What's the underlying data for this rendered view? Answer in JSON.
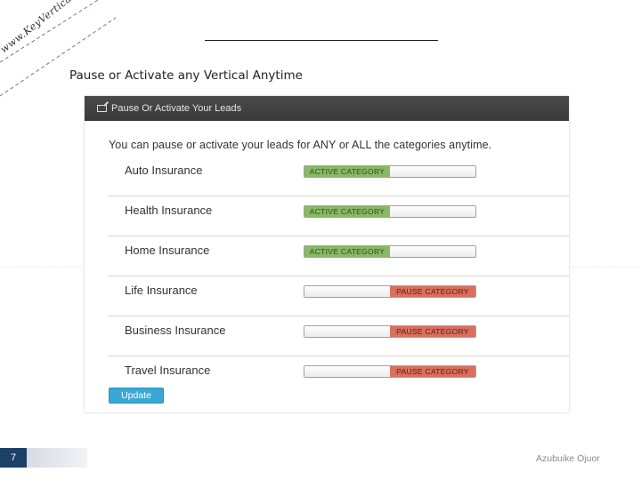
{
  "ribbon": {
    "text": "www.KeyVerticals.com"
  },
  "slide": {
    "heading": "Pause or Activate any Vertical Anytime"
  },
  "panel": {
    "header_title": "Pause Or Activate Your Leads",
    "header_icon": "edit-icon",
    "intro": "You can pause or activate your leads for ANY or ALL the categories anytime.",
    "toggle_labels": {
      "active": "ACTIVE CATEGORY",
      "pause": "PAUSE CATEGORY"
    },
    "categories": [
      {
        "label": "Auto Insurance",
        "state": "active"
      },
      {
        "label": "Health Insurance",
        "state": "active"
      },
      {
        "label": "Home Insurance",
        "state": "active"
      },
      {
        "label": "Life Insurance",
        "state": "paused"
      },
      {
        "label": "Business Insurance",
        "state": "paused"
      },
      {
        "label": "Travel Insurance",
        "state": "paused"
      }
    ],
    "update_button": "Update"
  },
  "footer": {
    "page_number": "7",
    "author": "Azubuike Ojuor"
  },
  "colors": {
    "active_green": "#88b964",
    "pause_red": "#d86f5f",
    "button_blue": "#3aa8d4",
    "header_dark": "#3f3f3f",
    "page_number_bg": "#1e3f66"
  }
}
